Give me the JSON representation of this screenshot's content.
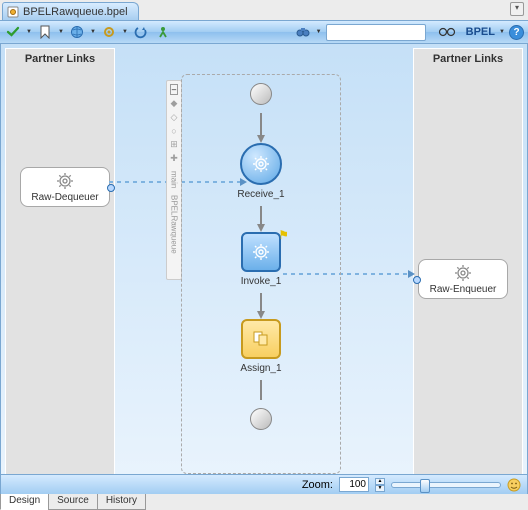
{
  "file": {
    "name": "BPELRawqueue.bpel"
  },
  "toolbar": {
    "mode_label": "BPEL"
  },
  "swimlanes": {
    "left_title": "Partner Links",
    "right_title": "Partner Links"
  },
  "partners": {
    "left": {
      "label": "Raw-Dequeuer"
    },
    "right": {
      "label": "Raw-Enqueuer"
    }
  },
  "flow": {
    "region_label": "main",
    "palette_label": "BPELRawqueue",
    "receive": {
      "label": "Receive_1"
    },
    "invoke": {
      "label": "Invoke_1"
    },
    "assign": {
      "label": "Assign_1"
    }
  },
  "status": {
    "zoom_label": "Zoom:",
    "zoom_value": "100"
  },
  "bottom_tabs": {
    "design": "Design",
    "source": "Source",
    "history": "History"
  }
}
